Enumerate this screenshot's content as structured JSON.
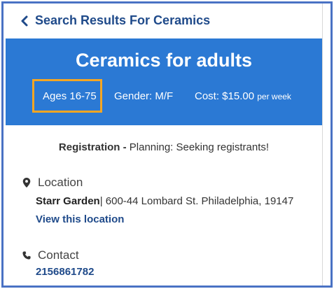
{
  "nav": {
    "back_label": "Search Results For Ceramics"
  },
  "program": {
    "title": "Ceramics for adults",
    "ages": "Ages 16-75",
    "gender": "Gender: M/F",
    "cost": "Cost: $15.00",
    "cost_period": "per week"
  },
  "registration": {
    "label": "Registration -",
    "status": "Planning: Seeking registrants!"
  },
  "location": {
    "heading": "Location",
    "name": "Starr Garden",
    "separator": "|",
    "address": "600-44 Lombard St. Philadelphia, 19147",
    "link_label": "View this location"
  },
  "contact": {
    "heading": "Contact",
    "phone": "2156861782"
  },
  "colors": {
    "hero_bg": "#2b79d4",
    "link": "#1f4a8a",
    "highlight": "#f5a623",
    "frame": "#4a72c4"
  },
  "icons": {
    "back": "chevron-left-icon",
    "location": "map-pin-icon",
    "contact": "phone-icon"
  }
}
